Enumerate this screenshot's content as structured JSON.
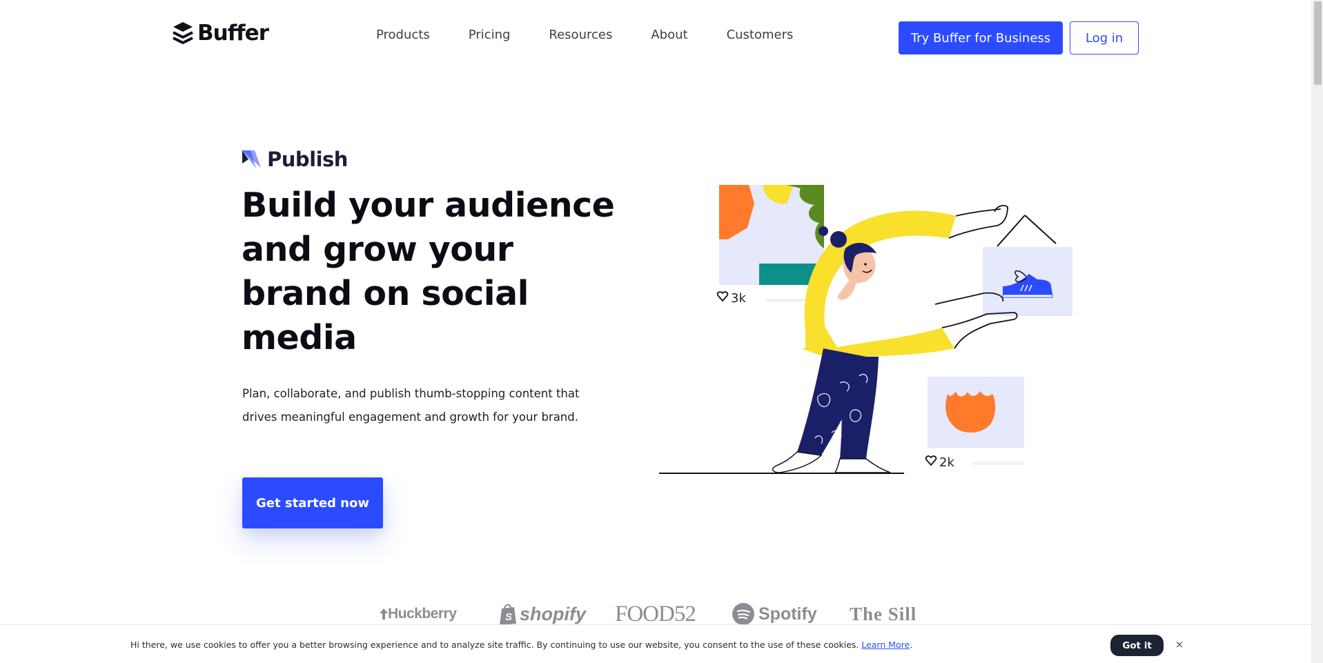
{
  "header": {
    "logo_text": "Buffer",
    "nav": [
      "Products",
      "Pricing",
      "Resources",
      "About",
      "Customers"
    ],
    "try_button": "Try Buffer for Business",
    "login_button": "Log in"
  },
  "hero": {
    "product_name": "Publish",
    "title": "Build your audience and grow your brand on social media",
    "subtitle": "Plan, collaborate, and publish thumb-stopping content that drives meaningful engagement and growth for your brand.",
    "cta": "Get started now",
    "illustration": {
      "post1_likes": "3k",
      "post2_likes": "2k"
    }
  },
  "customer_logos": [
    "Huckberry",
    "shopify",
    "FOOD52",
    "Spotify",
    "The Sill"
  ],
  "cookie_banner": {
    "text": "Hi there, we use cookies to offer you a better browsing experience and to analyze site traffic. By continuing to use our website, you consent to the use of these cookies. ",
    "link_text": "Learn More",
    "link_suffix": ".",
    "accept_button": "Got it",
    "close_icon": "×"
  },
  "colors": {
    "brand_blue": "#2c4bff",
    "dark_navy": "#1c2433",
    "illustration_yellow": "#f9e02c",
    "illustration_navy": "#1a2067",
    "illustration_orange": "#ff7a2b"
  }
}
